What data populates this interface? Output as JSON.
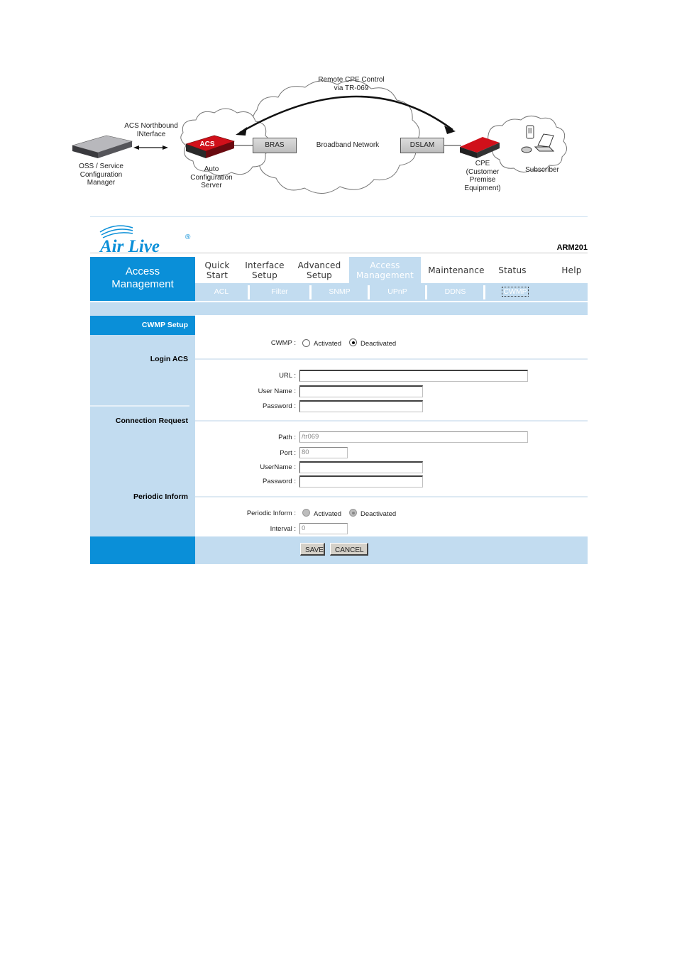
{
  "diagram": {
    "top_label": [
      "Remote CPE Control",
      "via TR-069"
    ],
    "northbound_label": [
      "ACS Northbound",
      "INterface"
    ],
    "oss_label": [
      "OSS / Service",
      "Configuration",
      "Manager"
    ],
    "acs_badge": "ACS",
    "acs_label": [
      "Auto",
      "Configuration",
      "Server"
    ],
    "bras": "BRAS",
    "network": "Broadband Network",
    "dslam": "DSLAM",
    "cpe_label": [
      "CPE",
      "(Customer",
      "Premise",
      "Equipment)"
    ],
    "subscriber": "Subscriber"
  },
  "header": {
    "logo": "Air Live",
    "logo_mark": "®",
    "model": "ARM201"
  },
  "sidebar": {
    "title_line1": "Access",
    "title_line2": "Management"
  },
  "nav": {
    "items": [
      {
        "line1": "Quick",
        "line2": "Start"
      },
      {
        "line1": "Interface",
        "line2": "Setup"
      },
      {
        "line1": "Advanced",
        "line2": "Setup"
      },
      {
        "line1": "Access",
        "line2": "Management",
        "active": true
      },
      {
        "line1": "Maintenance",
        "line2": ""
      },
      {
        "line1": "Status",
        "line2": ""
      },
      {
        "line1": "Help",
        "line2": ""
      }
    ],
    "subitems": [
      "ACL",
      "Filter",
      "SNMP",
      "UPnP",
      "DDNS",
      "CWMP"
    ],
    "active_subitem": "CWMP"
  },
  "sections": {
    "cwmp_setup": "CWMP Setup",
    "login_acs": "Login ACS",
    "connection_request": "Connection Request",
    "periodic_inform": "Periodic Inform"
  },
  "form": {
    "cwmp": {
      "label": "CWMP :",
      "options": [
        "Activated",
        "Deactivated"
      ],
      "selected": "Deactivated"
    },
    "url": {
      "label": "URL :",
      "value": ""
    },
    "user_name": {
      "label": "User Name :",
      "value": ""
    },
    "password": {
      "label": "Password :",
      "value": ""
    },
    "path": {
      "label": "Path :",
      "value": "/tr069"
    },
    "port": {
      "label": "Port :",
      "value": "80"
    },
    "conn_username": {
      "label": "UserName :",
      "value": ""
    },
    "conn_password": {
      "label": "Password :",
      "value": ""
    },
    "periodic_inform": {
      "label": "Periodic Inform :",
      "options": [
        "Activated",
        "Deactivated"
      ],
      "selected": "Deactivated"
    },
    "interval": {
      "label": "Interval :",
      "value": "0"
    }
  },
  "buttons": {
    "save": "SAVE",
    "cancel": "CANCEL"
  },
  "colors": {
    "primary_blue": "#0a8fd8",
    "light_blue": "#c2dcf0",
    "acs_red": "#d0101a"
  }
}
